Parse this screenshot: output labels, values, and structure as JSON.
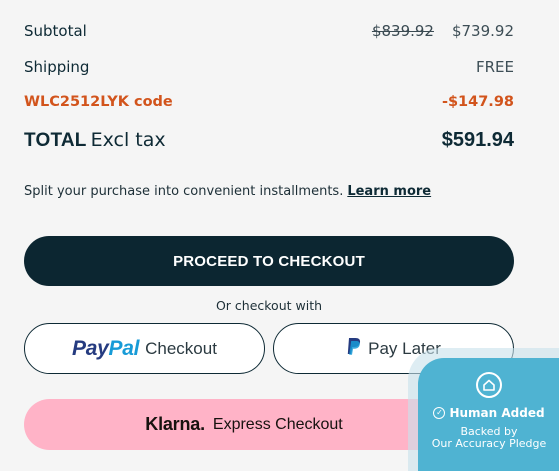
{
  "summary": {
    "subtotal_label": "Subtotal",
    "subtotal_original": "$839.92",
    "subtotal_price": "$739.92",
    "shipping_label": "Shipping",
    "shipping_value": "FREE",
    "promo_label": "WLC2512LYK code",
    "promo_value": "-$147.98",
    "total_label_bold": "TOTAL",
    "total_label_suffix": "Excl tax",
    "total_value": "$591.94"
  },
  "installments": {
    "text": "Split your purchase into convenient installments.",
    "link": "Learn more"
  },
  "checkout": {
    "button_label": "PROCEED TO CHECKOUT",
    "or_text": "Or checkout with"
  },
  "paypal": {
    "logo_pay": "Pay",
    "logo_pal": "Pal",
    "label": "Checkout"
  },
  "paylater": {
    "label": "Pay Later"
  },
  "klarna": {
    "logo": "Klarna.",
    "label": "Express Checkout"
  },
  "badge": {
    "title": "Human Added",
    "line1": "Backed by",
    "line2": "Our Accuracy Pledge"
  },
  "colors": {
    "primary": "#0c2631",
    "promo": "#d2541c",
    "klarna_pink": "#ffb3c7",
    "badge_blue": "#4fb3d2"
  }
}
